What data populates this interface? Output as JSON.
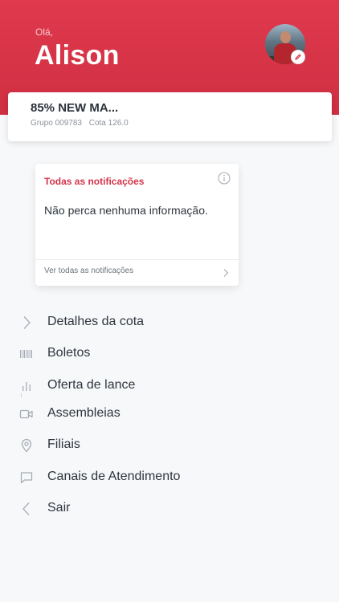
{
  "header": {
    "greeting": "Olá,",
    "username": "Alison",
    "avatar_icon": "user-photo",
    "edit_icon": "pencil-icon"
  },
  "group": {
    "title": "85% NEW MA...",
    "group_label": "Grupo 009783",
    "quota_label": "Cota 126.0"
  },
  "notifications": {
    "title": "Todas as notificações",
    "body": "Não perca nenhuma informação.",
    "link": "Ver todas as notificações",
    "info_icon": "info-icon"
  },
  "menu": {
    "items": [
      {
        "label": "Detalhes da cota",
        "icon": "chevron-right-icon"
      },
      {
        "label": "Boletos",
        "icon": "barcode-icon"
      },
      {
        "label": "Oferta de lance",
        "icon": "bar-chart-icon"
      },
      {
        "label": "Assembleias",
        "icon": "video-camera-icon"
      },
      {
        "label": "Filiais",
        "icon": "map-pin-icon"
      },
      {
        "label": "Canais de Atendimento",
        "icon": "chat-bubble-icon"
      },
      {
        "label": "Sair",
        "icon": "chevron-left-icon"
      }
    ]
  },
  "colors": {
    "brand": "#d3344a",
    "background": "#f7f8fa",
    "icon": "#a7adb4"
  }
}
